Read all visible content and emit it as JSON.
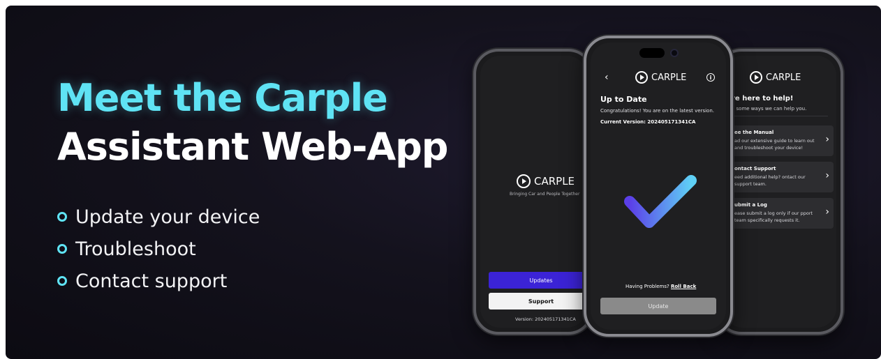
{
  "headline": {
    "line1": "Meet the Carple",
    "line2": "Assistant Web-App"
  },
  "bullets": [
    "Update your device",
    "Troubleshoot",
    "Contact support"
  ],
  "colors": {
    "accent_cyan": "#5fe3f4",
    "updates_button": "#3b23d6",
    "background": "#14121d"
  },
  "phone_left": {
    "brand": "CARPLE",
    "tagline": "Bringing Car and People Together",
    "updates_label": "Updates",
    "support_label": "Support",
    "version": "Version: 202405171341CA"
  },
  "phone_mid": {
    "brand": "CARPLE",
    "title": "Up to Date",
    "congrats": "Congratulations! You are on the latest version.",
    "current_version": "Current Version: 202405171341CA",
    "problem_text": "Having Problems?",
    "rollback_label": "Roll Back",
    "update_label": "Update",
    "icons": [
      "back-icon",
      "info-icon",
      "checkmark-icon"
    ]
  },
  "phone_right": {
    "brand": "CARPLE",
    "title": "re here to help!",
    "subtitle": "e some ways we can help you.",
    "cards": [
      {
        "title": "ee the Manual",
        "desc": "ad our extensive guide to learn out and troubleshoot your device!"
      },
      {
        "title": "ontact Support",
        "desc": "eed additional help? ontact our support team."
      },
      {
        "title": "ubmit a Log",
        "desc": "ease submit a log only if our pport team specifically requests it."
      }
    ]
  }
}
